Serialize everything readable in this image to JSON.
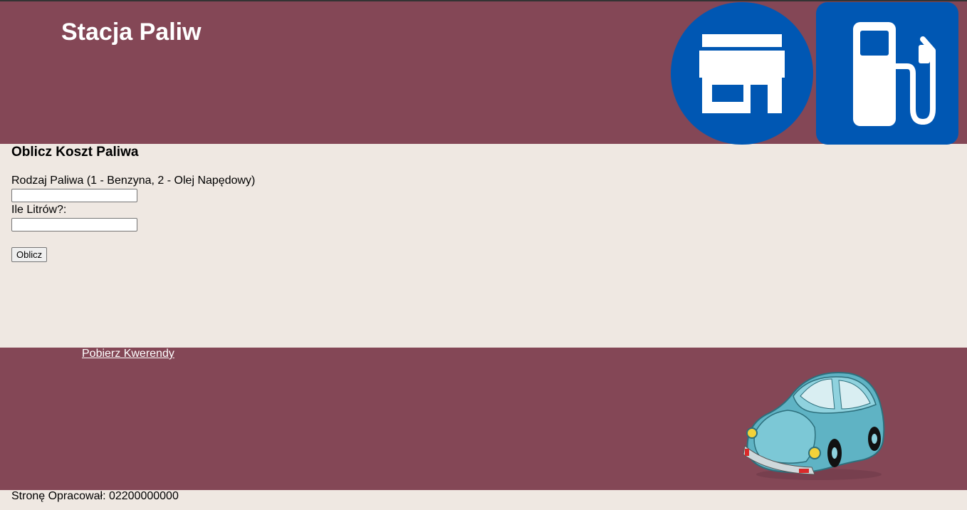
{
  "header": {
    "title": "Stacja Paliw",
    "shop_icon": "shop-icon",
    "fuel_icon": "fuel-pump-icon",
    "bg_color": "#844756",
    "icon_color": "#0057b3"
  },
  "form": {
    "heading": "Oblicz Koszt Paliwa",
    "fuel_type_label": "Rodzaj Paliwa (1 - Benzyna, 2 - Olej Napędowy)",
    "fuel_type_value": "",
    "liters_label": "Ile Litrów?:",
    "liters_value": "",
    "submit_label": "Oblicz"
  },
  "footer": {
    "link_text": "Pobierz Kwerendy",
    "car_image": "car-image"
  },
  "bottom": {
    "author_text": "Stronę Opracował: 02200000000"
  }
}
